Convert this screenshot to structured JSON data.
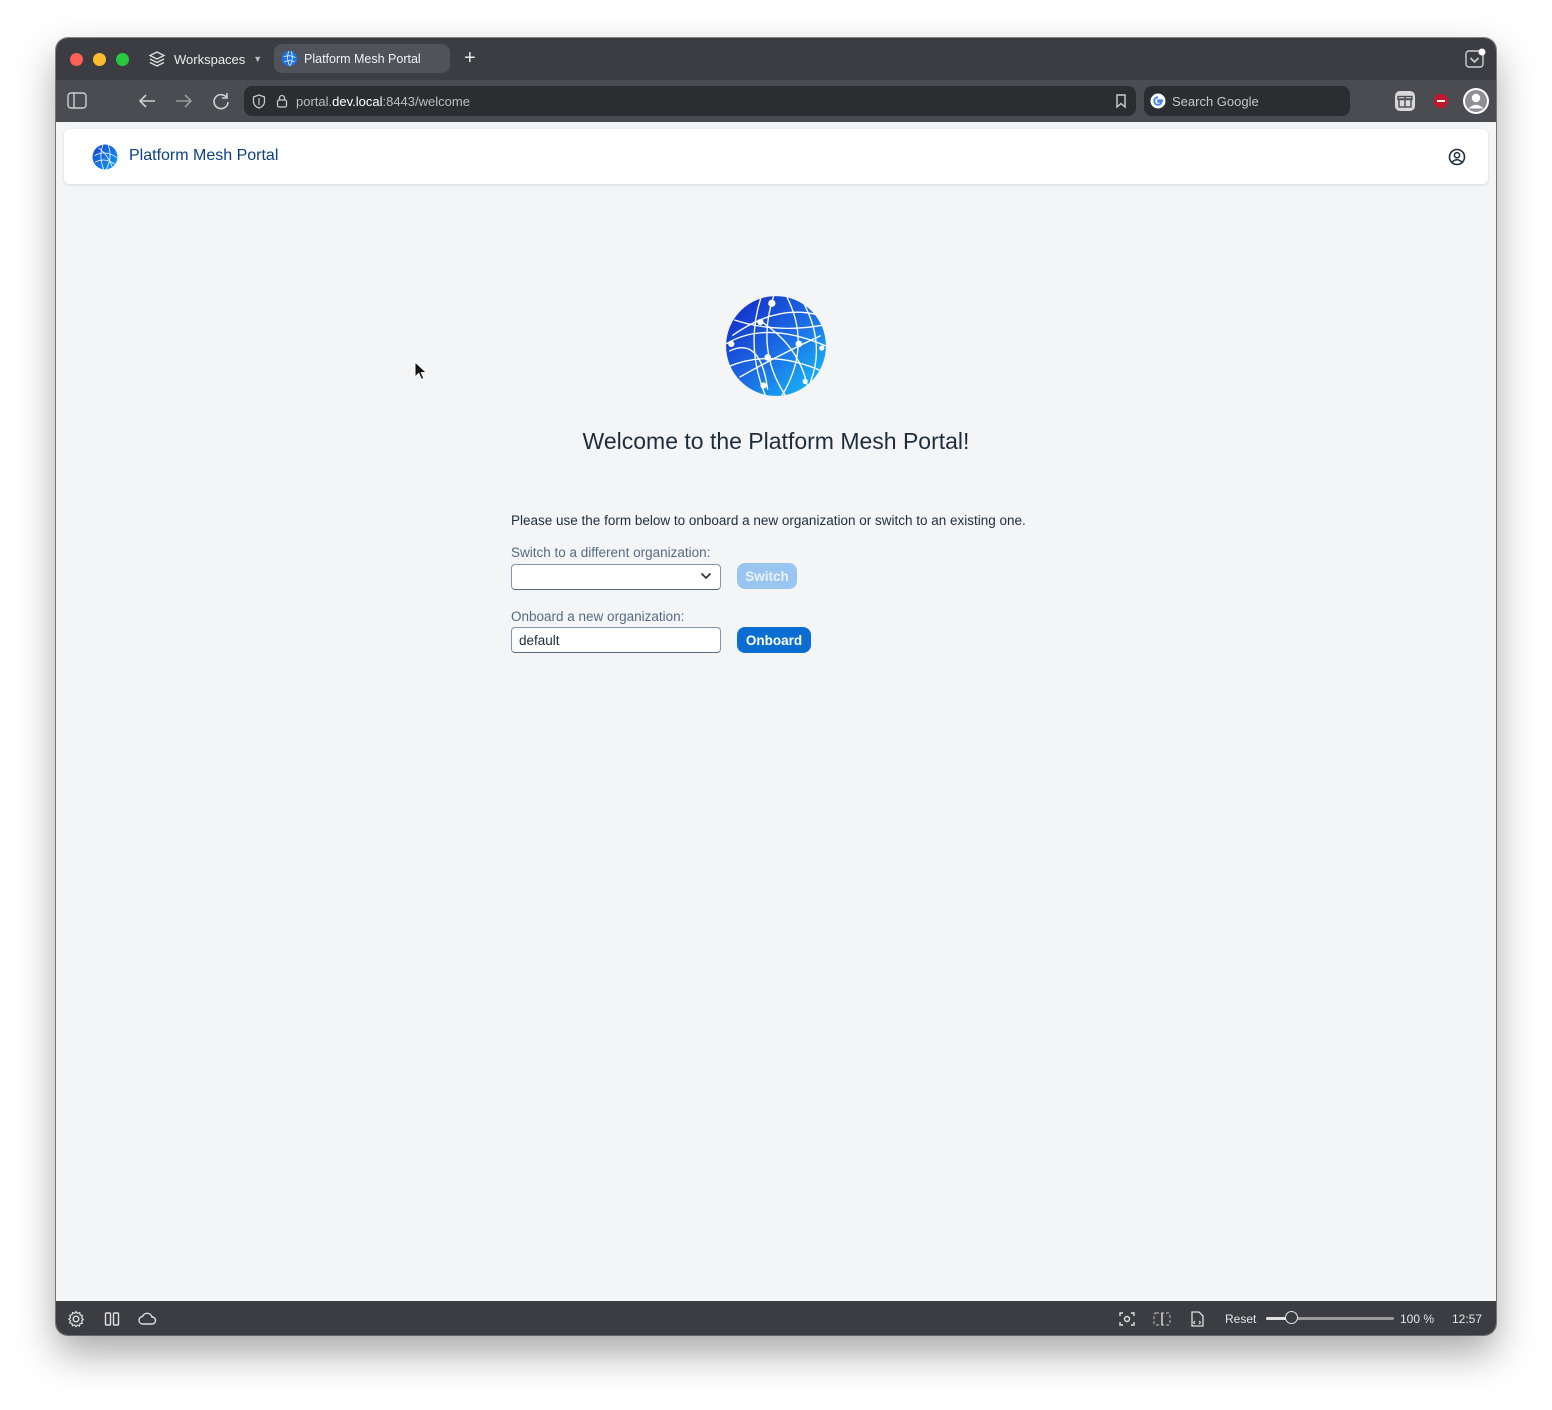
{
  "browser": {
    "workspaces_label": "Workspaces",
    "tab_title": "Platform Mesh Portal",
    "url": {
      "prefix": "portal.",
      "host": "dev.local",
      "suffix": ":8443/welcome"
    },
    "search_placeholder": "Search Google"
  },
  "app": {
    "title": "Platform Mesh Portal"
  },
  "welcome": {
    "heading": "Welcome to the Platform Mesh Portal!",
    "intro": "Please use the form below to onboard a new organization or switch to an existing one.",
    "switch_label": "Switch to a different organization:",
    "switch_button": "Switch",
    "onboard_label": "Onboard a new organization:",
    "onboard_value": "default",
    "onboard_button": "Onboard"
  },
  "statusbar": {
    "reset_label": "Reset",
    "zoom_text": "100 %",
    "zoom_fraction": 0.2,
    "clock": "12:57"
  },
  "colors": {
    "brand_blue": "#0a6ed1",
    "title_blue": "#0a3f86",
    "disabled_blue": "#99c5f1"
  }
}
